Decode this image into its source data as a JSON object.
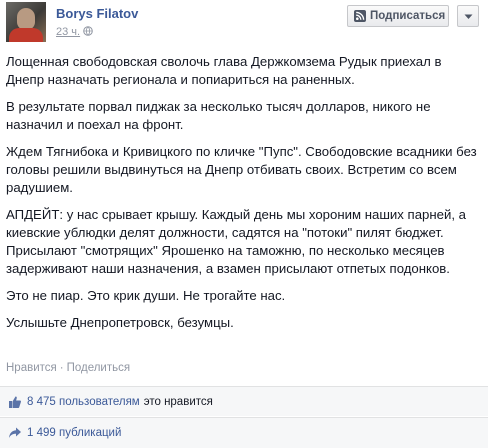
{
  "author": {
    "name": "Borys Filatov",
    "timestamp": "23 ч."
  },
  "header": {
    "subscribe_label": "Подписаться"
  },
  "post": {
    "paragraphs": [
      "Лощенная свободовская сволочь глава Держкомзема Рудык приехал в Днепр назначать регионала и попиариться на раненных.",
      "В результате порвал пиджак за несколько тысяч долларов, никого не назначил и поехал на фронт.",
      "Ждем Тягнибока и Кривицкого по кличке \"Пупс\". Свободовские всадники без головы решили выдвинуться на Днепр отбивать своих. Встретим со всем радушием.",
      "АПДЕЙТ: у нас срывает крышу. Каждый день мы хороним наших парней, а киевские ублюдки делят должности, садятся на \"потоки\" пилят бюджет. Присылают \"смотрящих\" Ярошенко на таможню, по несколько месяцев задерживают наши назначения, а взамен присылают отпетых подонков.",
      "Это не пиар. Это крик души. Не трогайте нас.",
      "Услышьте Днепропетровск, безумцы."
    ]
  },
  "actions": {
    "like": "Нравится",
    "separator": "·",
    "share": "Поделиться"
  },
  "ufi": {
    "likes_link": "8 475 пользователям",
    "likes_rest": "это нравится",
    "shares_link": "1 499 публикаций"
  },
  "colors": {
    "link": "#3b5998",
    "muted": "#9197a3",
    "ufi_bg": "#f6f7f8"
  },
  "icons": {
    "privacy": "globe-icon",
    "subscribe": "rss-icon",
    "menu": "chevron-down-icon",
    "like": "thumbs-up-icon",
    "share": "share-icon"
  }
}
